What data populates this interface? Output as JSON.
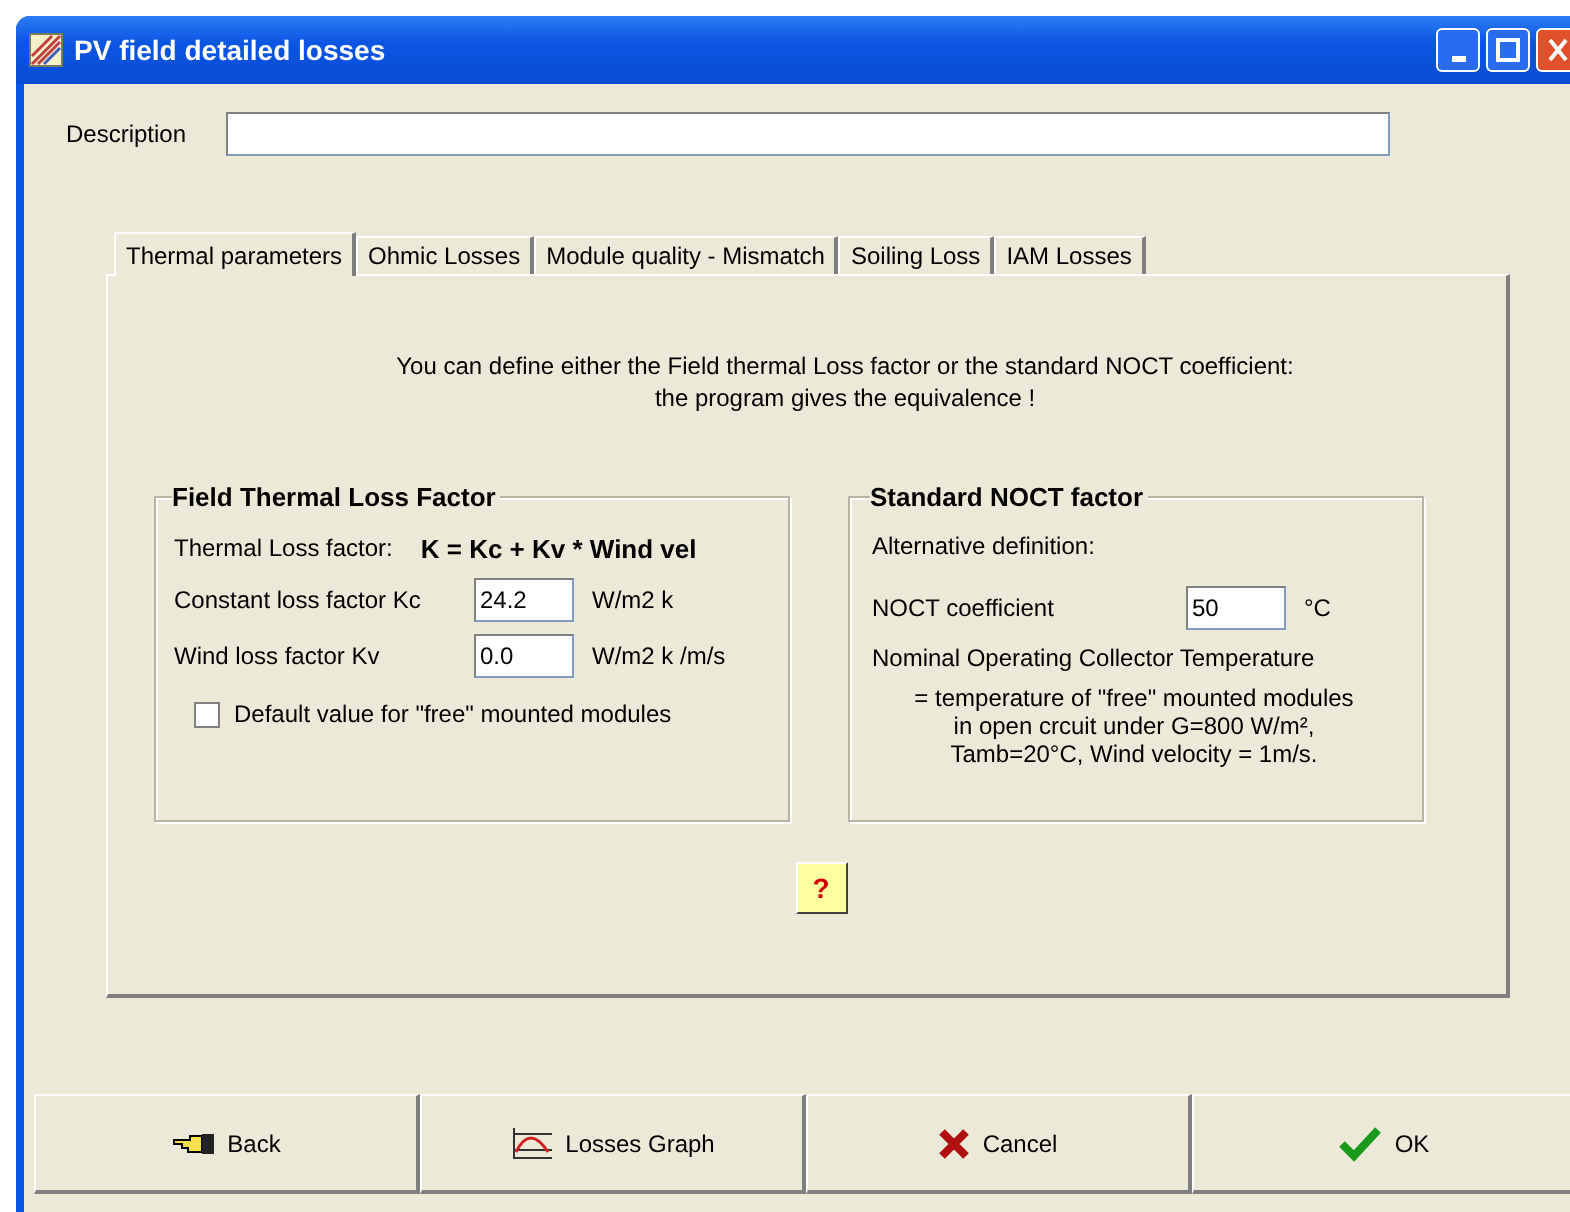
{
  "window": {
    "title": "PV field detailed losses"
  },
  "description": {
    "label": "Description"
  },
  "tabs": [
    {
      "label": "Thermal parameters",
      "selected": true
    },
    {
      "label": "Ohmic Losses",
      "selected": false
    },
    {
      "label": "Module quality - Mismatch",
      "selected": false
    },
    {
      "label": "Soiling Loss",
      "selected": false
    },
    {
      "label": "IAM Losses",
      "selected": false
    }
  ],
  "intro": [
    "You can define  either the Field thermal Loss factor or the standard NOCT coefficient:",
    "the program gives the equivalence !"
  ],
  "field_group": {
    "title": "Field Thermal Loss Factor",
    "formula_label": "Thermal Loss factor:",
    "formula": "K = Kc + Kv * Wind vel",
    "rows": [
      {
        "label": "Constant loss factor  Kc",
        "value": "24.2",
        "unit": "W/m2 k"
      },
      {
        "label": "Wind loss factor  Kv",
        "value": "0.0",
        "unit": "W/m2 k /m/s"
      }
    ],
    "default_checkbox": {
      "label": "Default value for \"free\" mounted modules",
      "checked": false
    }
  },
  "noct_group": {
    "title": "Standard NOCT factor",
    "subtitle": "Alternative definition:",
    "label": "NOCT coefficient",
    "value": "50",
    "unit": "°C",
    "caption": "Nominal Operating Collector Temperature",
    "note": [
      "= temperature of \"free\" mounted modules",
      "in open crcuit under G=800 W/m²,",
      "Tamb=20°C, Wind velocity = 1m/s."
    ]
  },
  "help_button": "?",
  "buttons": [
    {
      "kind": "back",
      "label": "Back"
    },
    {
      "kind": "graph",
      "label": "Losses Graph"
    },
    {
      "kind": "cancel",
      "label": "Cancel"
    },
    {
      "kind": "ok",
      "label": "OK"
    }
  ]
}
